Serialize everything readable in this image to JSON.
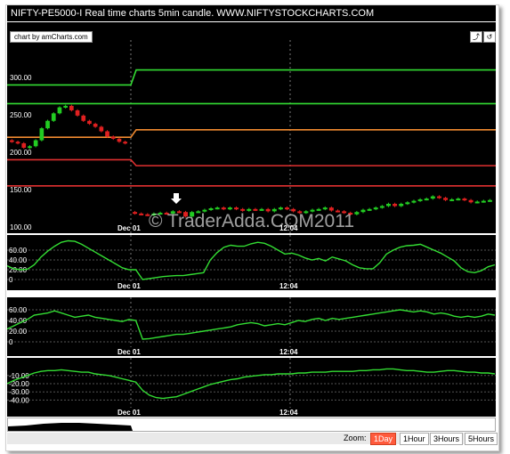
{
  "title": "NIFTY-PE5000-I  Real time charts 5min candle.  WWW.NIFTYSTOCKCHARTS.COM",
  "amcharts_link": "chart by amCharts.com",
  "watermark": "© TraderAdda.COM2011",
  "colors": {
    "background": "#000000",
    "up_candle": "#22cc22",
    "down_candle": "#e02020",
    "line_green": "#33dd33",
    "line_orange": "#f08a30",
    "line_red": "#e03030",
    "grid": "#555555",
    "active_zoom": "#ff5a3c"
  },
  "icons": [
    "zoom-out-icon",
    "reset-icon",
    "arrow-down-icon"
  ],
  "x_axis_labels": [
    "Dec 01",
    "12:04"
  ],
  "zoom": {
    "label": "Zoom:",
    "buttons": [
      "1Day",
      "1Hour",
      "3Hours",
      "5Hours"
    ],
    "active": "1Day"
  },
  "chart_data": [
    {
      "type": "line",
      "name": "price",
      "ylim": [
        100,
        350
      ],
      "yticks": [
        "300.00",
        "250.00",
        "200.00",
        "150.00",
        "100.00"
      ],
      "vertical_markers": [
        "Dec 01",
        "12:04"
      ],
      "hlines": [
        {
          "color": "green",
          "before": 290,
          "after": 310
        },
        {
          "color": "green",
          "before": 265,
          "after": 265
        },
        {
          "color": "orange",
          "before": 220,
          "after": 230
        },
        {
          "color": "red",
          "before": 190,
          "after": 182
        },
        {
          "color": "red",
          "before": 155,
          "after": 155
        }
      ],
      "candles_close_session1": [
        214,
        212,
        206,
        208,
        216,
        232,
        242,
        252,
        260,
        262,
        256,
        249,
        242,
        238,
        234,
        228,
        221,
        218,
        214,
        212
      ],
      "candles_close_session2": [
        118,
        117,
        116,
        118,
        119,
        118,
        121,
        120,
        114,
        120,
        121,
        123,
        125,
        126,
        124,
        126,
        124,
        122,
        124,
        123,
        124,
        121,
        124,
        126,
        124,
        121,
        119,
        121,
        123,
        124,
        126,
        122,
        121,
        119,
        117,
        120,
        123,
        124,
        126,
        128,
        131,
        128,
        131,
        133,
        135,
        137,
        138,
        141,
        139,
        136,
        137,
        138,
        136,
        133,
        134,
        135,
        136
      ]
    },
    {
      "type": "line",
      "ylim": [
        0,
        80
      ],
      "yticks": [
        "60.00",
        "40.00",
        "20.00",
        "0"
      ],
      "values": [
        28,
        22,
        20,
        21,
        30,
        46,
        58,
        68,
        76,
        79,
        78,
        72,
        64,
        56,
        48,
        40,
        32,
        24,
        20,
        20,
        0,
        2,
        4,
        6,
        7,
        8,
        8,
        10,
        12,
        14,
        40,
        55,
        66,
        70,
        68,
        68,
        73,
        76,
        74,
        68,
        60,
        52,
        54,
        50,
        44,
        40,
        43,
        38,
        46,
        42,
        38,
        30,
        24,
        22,
        22,
        34,
        52,
        60,
        66,
        69,
        70,
        72,
        66,
        60,
        54,
        46,
        38,
        24,
        16,
        14,
        18,
        26,
        30
      ]
    },
    {
      "type": "line",
      "ylim": [
        0,
        70
      ],
      "yticks": [
        "60.00",
        "40.00",
        "20.00",
        "0"
      ],
      "values": [
        24,
        30,
        36,
        42,
        50,
        52,
        54,
        58,
        54,
        50,
        46,
        48,
        50,
        46,
        44,
        42,
        40,
        38,
        42,
        40,
        5,
        6,
        8,
        10,
        12,
        14,
        14,
        16,
        18,
        20,
        22,
        24,
        26,
        28,
        32,
        34,
        36,
        34,
        30,
        32,
        34,
        32,
        36,
        40,
        38,
        42,
        44,
        40,
        44,
        42,
        44,
        46,
        48,
        50,
        52,
        54,
        56,
        58,
        60,
        58,
        56,
        58,
        56,
        52,
        54,
        52,
        48,
        46,
        48,
        46,
        48,
        52,
        50
      ]
    },
    {
      "type": "line",
      "ylim": [
        -45,
        5
      ],
      "yticks": [
        "-10.00",
        "-20.00",
        "-30.00",
        "-40.00"
      ],
      "values": [
        -20,
        -16,
        -13,
        -10,
        -7,
        -5,
        -4,
        -4,
        -3,
        -4,
        -5,
        -6,
        -6,
        -8,
        -9,
        -10,
        -12,
        -14,
        -16,
        -18,
        -28,
        -34,
        -37,
        -38,
        -37,
        -36,
        -33,
        -30,
        -27,
        -24,
        -21,
        -19,
        -17,
        -15,
        -14,
        -12,
        -11,
        -10,
        -9,
        -9,
        -8,
        -8,
        -8,
        -7,
        -7,
        -6,
        -6,
        -6,
        -5,
        -5,
        -5,
        -5,
        -4,
        -4,
        -3,
        -3,
        -2,
        -2,
        -3,
        -4,
        -4,
        -5,
        -6,
        -6,
        -5,
        -4,
        -4,
        -5,
        -6,
        -6,
        -7,
        -7,
        -8
      ]
    }
  ]
}
